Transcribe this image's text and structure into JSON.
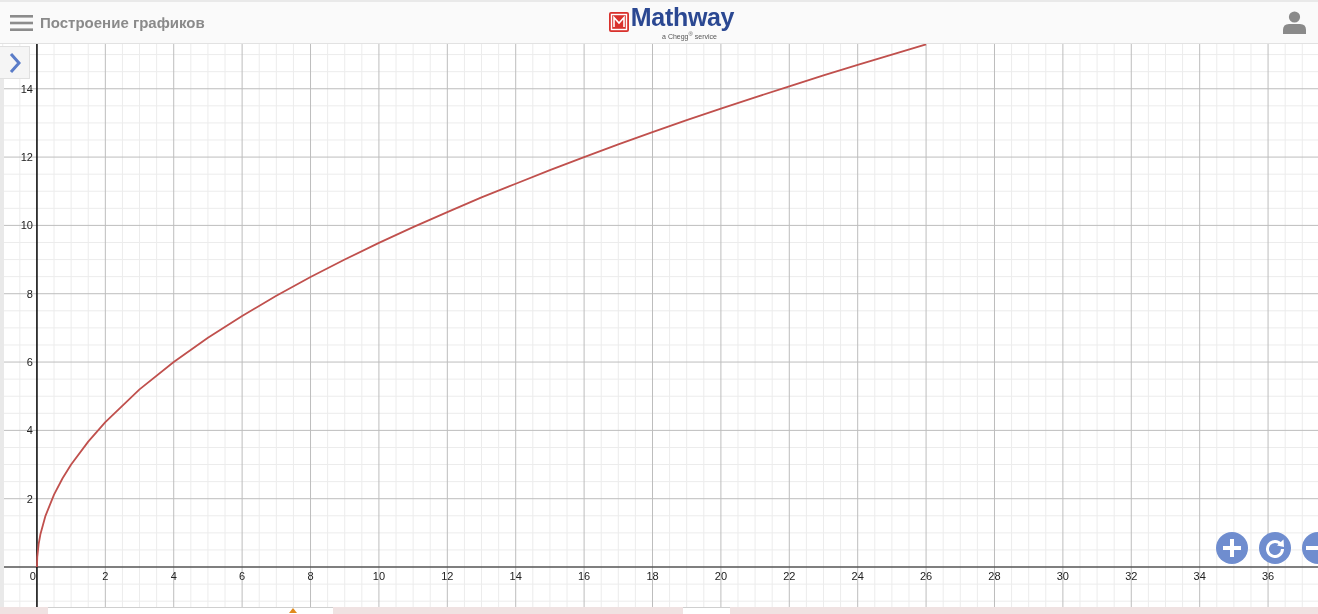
{
  "header": {
    "title": "Построение графиков",
    "logo": {
      "name": "Mathway",
      "tagline": "a Chegg$^{®}$ service"
    }
  },
  "graph": {
    "chart_data": {
      "type": "line",
      "x": [
        0,
        0.01,
        0.05,
        0.1,
        0.25,
        0.5,
        0.75,
        1,
        1.5,
        2,
        3,
        4,
        5,
        6,
        7,
        8,
        9,
        10,
        11,
        12,
        13,
        14,
        15,
        16,
        17,
        18,
        19,
        20,
        21,
        22,
        23,
        24,
        25,
        26
      ],
      "series": [
        {
          "color": "#c0504d",
          "values": [
            0,
            0.3,
            0.67,
            0.95,
            1.5,
            2.12,
            2.6,
            3,
            3.67,
            4.24,
            5.2,
            6,
            6.71,
            7.35,
            7.94,
            8.49,
            9,
            9.49,
            9.95,
            10.39,
            10.82,
            11.22,
            11.62,
            12,
            12.37,
            12.73,
            13.08,
            13.42,
            13.75,
            14.07,
            14.39,
            14.7,
            15,
            15.3
          ]
        }
      ],
      "xlim": [
        -1.08,
        37.46
      ],
      "ylim": [
        -1.17,
        15.31
      ],
      "xticks": [
        0,
        2,
        4,
        6,
        8,
        10,
        12,
        14,
        16,
        18,
        20,
        22,
        24,
        26,
        28,
        30,
        32,
        34,
        36
      ],
      "yticks": [
        2,
        4,
        6,
        8,
        10,
        12,
        14
      ],
      "grid": true
    }
  }
}
